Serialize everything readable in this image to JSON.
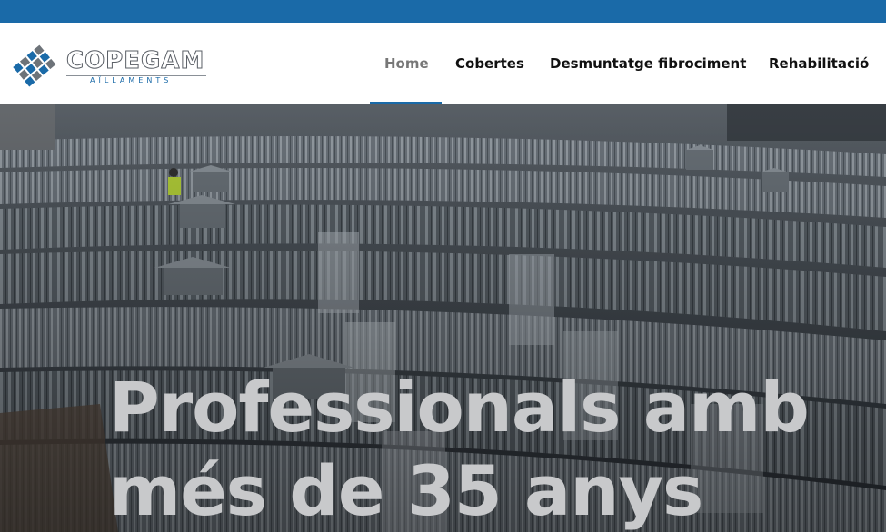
{
  "brand": {
    "name": "COPEGAM",
    "tagline": "AÏLLAMENTS",
    "accent_color": "#1a6aa8",
    "logo_icon": "diamond-tiles-logo"
  },
  "nav": {
    "items": [
      {
        "label": "Home",
        "active": true
      },
      {
        "label": "Cobertes",
        "active": false
      },
      {
        "label": "Desmuntatge fibrociment",
        "active": false
      },
      {
        "label": "Rehabilitació",
        "active": false
      }
    ]
  },
  "hero": {
    "title_line1": "Professionals amb",
    "title_line2": "més de 35 anys",
    "image_subject": "metal arched roofs with ventilators"
  }
}
